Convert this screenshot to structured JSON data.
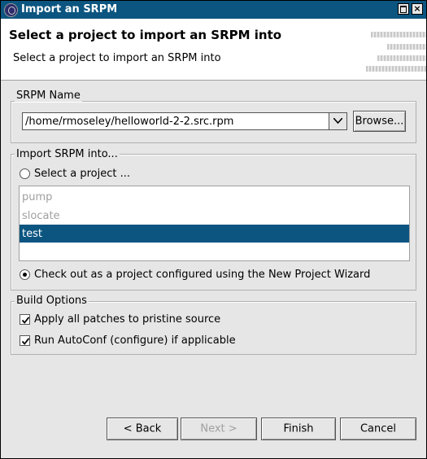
{
  "window": {
    "title": "Import an SRPM"
  },
  "header": {
    "title": "Select a project to import an SRPM into",
    "subtitle": "Select a project to import an SRPM into"
  },
  "srpm": {
    "group_label": "SRPM Name",
    "path_value": "/home/rmoseley/helloworld-2-2.src.rpm",
    "browse_label": "Browse..."
  },
  "import_into": {
    "group_label": "Import SRPM into...",
    "select_project_label": "Select a project ...",
    "select_project_checked": false,
    "projects": [
      {
        "name": "pump",
        "state": "disabled"
      },
      {
        "name": "slocate",
        "state": "disabled"
      },
      {
        "name": "test",
        "state": "selected"
      }
    ],
    "checkout_label": "Check out as a project configured using the New Project Wizard",
    "checkout_checked": true
  },
  "build_options": {
    "group_label": "Build Options",
    "apply_patches_label": "Apply all patches to pristine source",
    "apply_patches_checked": true,
    "autoconf_label": "Run AutoConf (configure) if applicable",
    "autoconf_checked": true
  },
  "buttons": {
    "back": "< Back",
    "next": "Next >",
    "finish": "Finish",
    "cancel": "Cancel"
  },
  "colors": {
    "titlebar": "#0b5580",
    "selection": "#0b5580",
    "panel": "#e6e6e6"
  },
  "icons": [
    "app-icon",
    "maximize-icon",
    "close-icon",
    "dropdown-arrow-icon",
    "checkmark-icon"
  ]
}
